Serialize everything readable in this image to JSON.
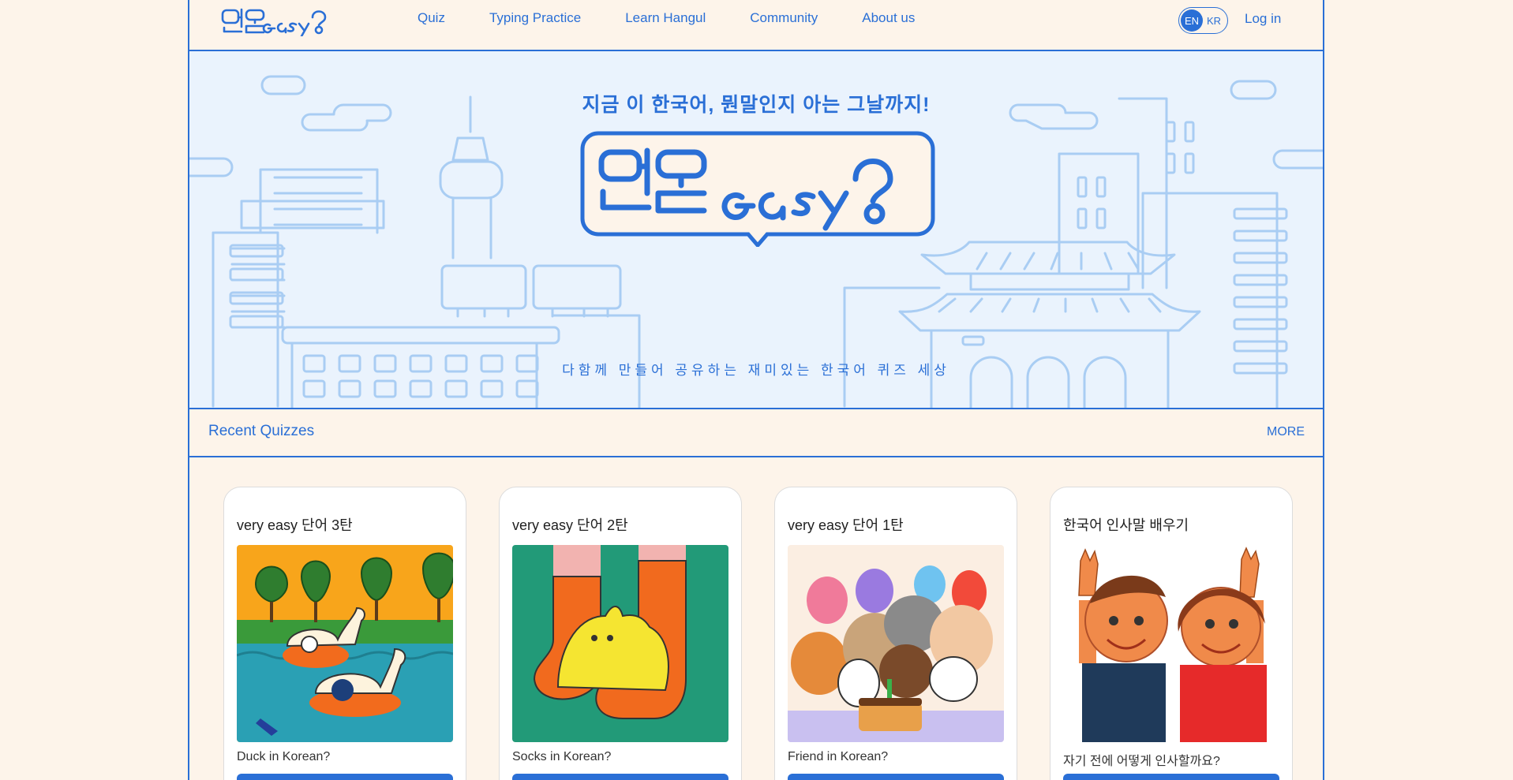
{
  "nav": {
    "logo_alt": "뭔말easy?",
    "links": [
      {
        "label": "Quiz"
      },
      {
        "label": "Typing Practice"
      },
      {
        "label": "Learn Hangul"
      },
      {
        "label": "Community"
      },
      {
        "label": "About us"
      }
    ],
    "lang_en": "EN",
    "lang_kr": "KR",
    "login": "Log in"
  },
  "hero": {
    "tagline": "지금 이 한국어, 뭔말인지 아는 그날까지!",
    "subtitle": "다함께 만들어 공유하는 재미있는 한국어 퀴즈 세상"
  },
  "section": {
    "title": "Recent Quizzes",
    "more": "MORE"
  },
  "cards": [
    {
      "title": "very easy 단어 3탄",
      "desc": "Duck in Korean?",
      "image": "ducks-pond-illustration"
    },
    {
      "title": "very easy 단어 2탄",
      "desc": "Socks in Korean?",
      "image": "cat-socks-illustration"
    },
    {
      "title": "very easy 단어 1탄",
      "desc": "Friend in Korean?",
      "image": "friends-party-illustration"
    },
    {
      "title": "한국어 인사말 배우기",
      "desc": "자기 전에 어떻게 인사할까요?",
      "image": "two-kids-waving-illustration"
    }
  ],
  "colors": {
    "accent": "#2a6fd6",
    "page_bg": "#fdf4ea",
    "hero_bg": "#eaf3fd"
  }
}
